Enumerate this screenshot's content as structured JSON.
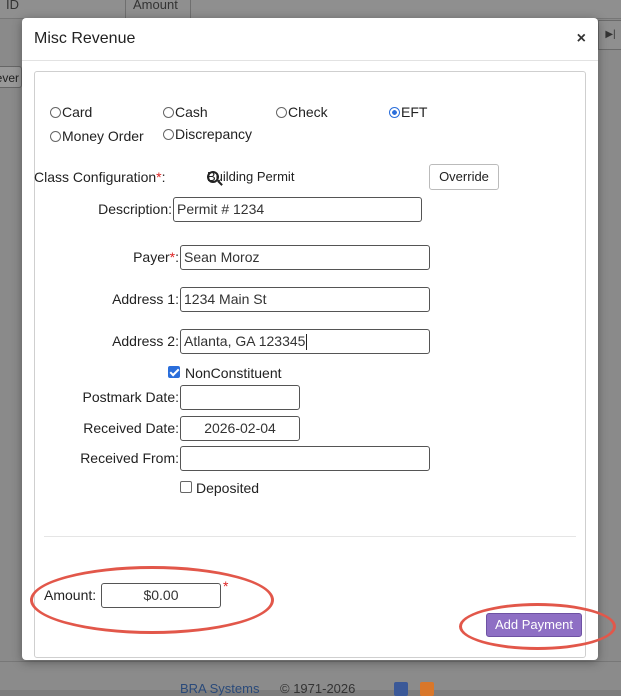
{
  "background": {
    "col_id": "ID",
    "col_amount": "Amount",
    "rev_fragment": "ever",
    "nav_icon": "skip-end-icon",
    "footer_link": "BRA Systems",
    "footer_year": "© 1971-2026"
  },
  "modal": {
    "title": "Misc Revenue",
    "close": "×"
  },
  "payment_types": [
    {
      "label": "Card",
      "selected": false
    },
    {
      "label": "Cash",
      "selected": false
    },
    {
      "label": "Check",
      "selected": false
    },
    {
      "label": "EFT",
      "selected": true
    },
    {
      "label": "Money Order",
      "selected": false
    },
    {
      "label": "Discrepancy",
      "selected": false
    }
  ],
  "form": {
    "class_config_label": "Class Configuration",
    "class_config_value": "Building Permit",
    "override_label": "Override",
    "description_label": "Description:",
    "description_value": "Permit # 1234",
    "payer_label": "Payer",
    "payer_value": "Sean Moroz",
    "address1_label": "Address 1:",
    "address1_value": "1234 Main St",
    "address2_label": "Address 2:",
    "address2_value": "Atlanta, GA 123345",
    "nonconstituent_label": "NonConstituent",
    "nonconstituent_checked": true,
    "postmark_label": "Postmark Date:",
    "postmark_value": "",
    "received_date_label": "Received Date:",
    "received_date_value": "2026-02-04",
    "received_from_label": "Received From:",
    "received_from_value": "",
    "deposited_label": "Deposited",
    "deposited_checked": false,
    "amount_label": "Amount:",
    "amount_value": "$0.00",
    "required_mark": "*",
    "add_payment_label": "Add Payment"
  },
  "colors": {
    "accent_button": "#8e6fc4",
    "annotation_ellipse": "#e2574a",
    "required": "#dd2222"
  }
}
